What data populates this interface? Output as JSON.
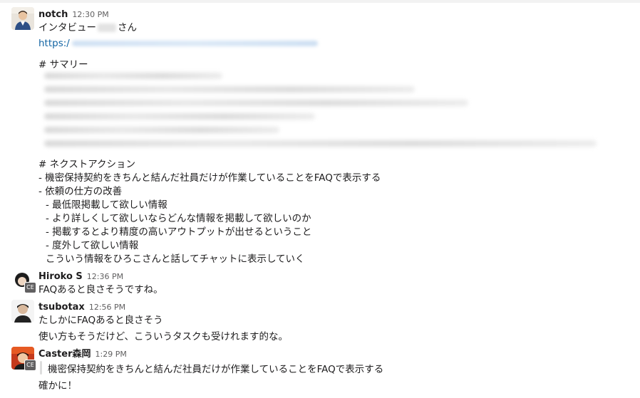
{
  "messages": [
    {
      "author": "notch",
      "time": "12:30 PM",
      "lines": [
        {
          "pre": "インタビュー",
          "post": "さん"
        },
        {
          "link": "https:/"
        },
        {
          "text": "# サマリー"
        },
        {
          "text": "# ネクストアクション"
        },
        {
          "text": "- 機密保持契約をきちんと結んだ社員だけが作業していることをFAQで表示する"
        },
        {
          "text": "- 依頼の仕方の改善"
        },
        {
          "text": "  - 最低限掲載して欲しい情報"
        },
        {
          "text": "  - より詳しくして欲しいならどんな情報を掲載して欲しいのか"
        },
        {
          "text": "  - 掲載するとより精度の高いアウトプットが出せるということ"
        },
        {
          "text": "  - 度外して欲しい情報"
        },
        {
          "text": "  こういう情報をひろこさんと話してチャットに表示していく"
        }
      ]
    },
    {
      "author": "Hiroko S",
      "time": "12:36 PM",
      "badge": "CE",
      "lines": [
        {
          "text": "FAQあると良さそうですね。"
        }
      ]
    },
    {
      "author": "tsubotax",
      "time": "12:56 PM",
      "lines": [
        {
          "text": "たしかにFAQあると良さそう"
        },
        {
          "text": "使い方もそうだけど、こういうタスクも受けれます的な。"
        }
      ]
    },
    {
      "author": "Caster森岡",
      "time": "1:29 PM",
      "badge": "CE",
      "lines": [
        {
          "text": "機密保持契約をきちんと結んだ社員だけが作業していることをFAQで表示する"
        },
        {
          "text": "確かに！"
        }
      ]
    }
  ],
  "colors": {
    "link": "#1264a3",
    "text": "#1d1c1d",
    "time": "#616061"
  },
  "icons": [
    "avatar-notch",
    "avatar-hiroko",
    "avatar-tsubotax",
    "avatar-caster"
  ]
}
